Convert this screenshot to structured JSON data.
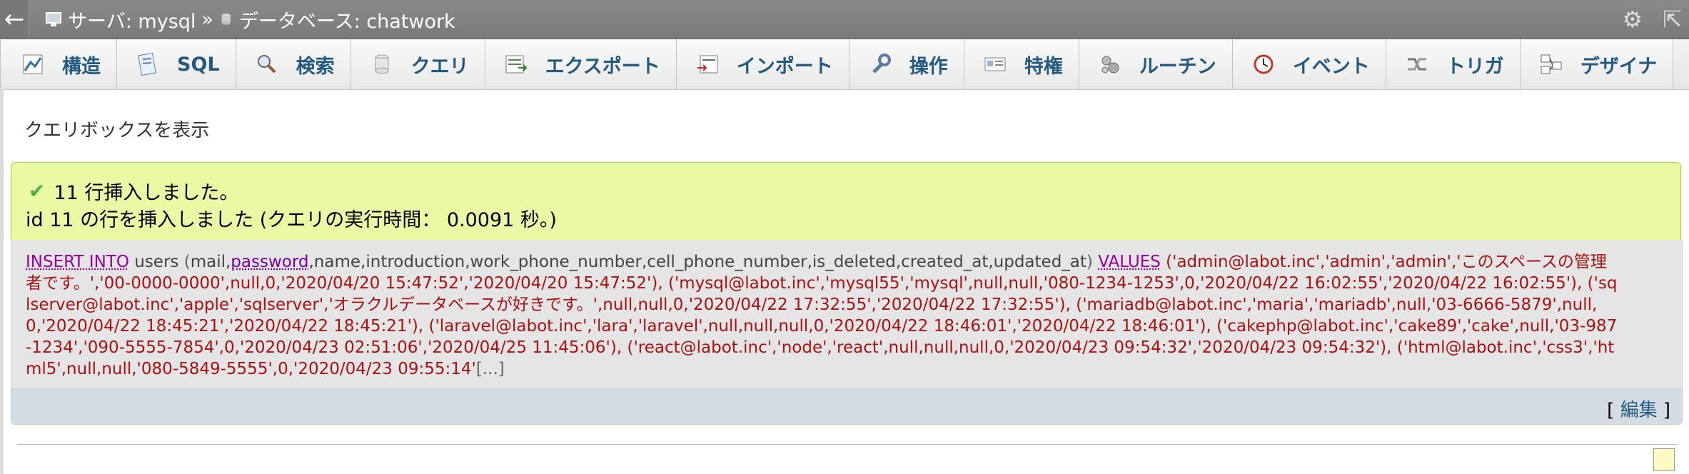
{
  "breadcrumb": {
    "server_label": "サーバ: mysql",
    "separator": "»",
    "database_label": "データベース: chatwork"
  },
  "tabs": [
    {
      "label": "構造",
      "icon": "structure-icon"
    },
    {
      "label": "SQL",
      "icon": "sql-icon"
    },
    {
      "label": "検索",
      "icon": "search-icon"
    },
    {
      "label": "クエリ",
      "icon": "query-icon"
    },
    {
      "label": "エクスポート",
      "icon": "export-icon"
    },
    {
      "label": "インポート",
      "icon": "import-icon"
    },
    {
      "label": "操作",
      "icon": "wrench-icon"
    },
    {
      "label": "特権",
      "icon": "privileges-icon"
    },
    {
      "label": "ルーチン",
      "icon": "routines-icon"
    },
    {
      "label": "イベント",
      "icon": "events-icon"
    },
    {
      "label": "トリガ",
      "icon": "triggers-icon"
    },
    {
      "label": "デザイナ",
      "icon": "designer-icon"
    }
  ],
  "show_querybox": "クエリボックスを表示",
  "result": {
    "line1": "11 行挿入しました。",
    "line2": "id 11 の行を挿入しました (クエリの実行時間： 0.0091 秒。)"
  },
  "sql": {
    "insert_into": "INSERT INTO",
    "table": "users",
    "open_paren": " (",
    "columns_before": "mail,",
    "password": "password",
    "columns_after": ",name,introduction,work_phone_number,cell_phone_number,is_deleted,created_at,updated_at",
    "close_paren": ") ",
    "values_kw": "VALUES",
    "values_1": " ('admin@labot.inc','admin','admin','このスペースの管理者です。','00-0000-0000',null,0,'2020/04/20 15:47:52','2020/04/20 15:47:52'), ",
    "values_2": "('mysql@labot.inc','mysql55','mysql',null,null,'080-1234-1253',0,'2020/04/22 16:02:55','2020/04/22 16:02:55'), ",
    "values_3": "('sqlserver@labot.inc','apple','sqlserver','オラクルデータベースが好きです。',null,null,0,'2020/04/22 17:32:55','2020/04/22 17:32:55'), ",
    "values_4": "('mariadb@labot.inc','maria','mariadb',null,'03-6666-5879',null,0,'2020/04/22 18:45:21','2020/04/22 18:45:21'), ",
    "values_5": "('laravel@labot.inc','lara','laravel',null,null,null,0,'2020/04/22 18:46:01','2020/04/22 18:46:01'), ",
    "values_6": "('cakephp@labot.inc','cake89','cake',null,'03-987-1234','090-5555-7854',0,'2020/04/23 02:51:06','2020/04/25 11:45:06'), ",
    "values_7": "('react@labot.inc','node','react',null,null,null,0,'2020/04/23 09:54:32','2020/04/23 09:54:32'), ",
    "values_8": "('html@labot.inc','css3','html5',null,null,'080-5849-5555',0,'2020/04/23 09:55:14'",
    "ellipsis": "[...]"
  },
  "edit": {
    "open": "[ ",
    "label": "編集",
    "close": " ]"
  },
  "colors": {
    "success_bg": "#ebf8a4",
    "success_border": "#a2d246",
    "tab_text": "#235a81",
    "topbar_bg": "#7f7f7f",
    "sql_keyword": "#990099",
    "sql_string": "#aa1111"
  }
}
